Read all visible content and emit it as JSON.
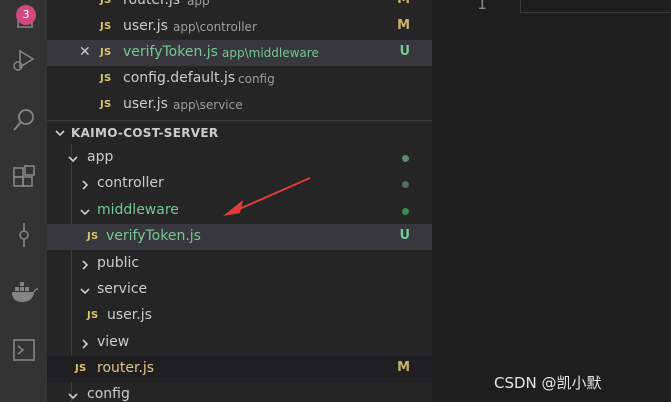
{
  "activity_bar": {
    "badge": "3",
    "icons": [
      "files-icon",
      "run-debug-icon",
      "search-icon",
      "extensions-icon",
      "source-control-icon",
      "docker-icon",
      "terminal-icon"
    ]
  },
  "open_editors": [
    {
      "name": "router.js",
      "path": "app",
      "status": "M"
    },
    {
      "name": "user.js",
      "path": "app\\controller",
      "status": "M"
    },
    {
      "name": "verifyToken.js",
      "path": "app\\middleware",
      "status": "U"
    },
    {
      "name": "config.default.js",
      "path": "config",
      "status": ""
    },
    {
      "name": "user.js",
      "path": "app\\service",
      "status": ""
    }
  ],
  "project": {
    "name": "KAIMO-COST-SERVER",
    "tree": [
      {
        "label": "app",
        "type": "folder-open"
      },
      {
        "label": "controller",
        "type": "folder"
      },
      {
        "label": "middleware",
        "type": "folder-open"
      },
      {
        "label": "verifyToken.js",
        "type": "file",
        "status": "U"
      },
      {
        "label": "public",
        "type": "folder"
      },
      {
        "label": "service",
        "type": "folder-open"
      },
      {
        "label": "user.js",
        "type": "file"
      },
      {
        "label": "view",
        "type": "folder"
      },
      {
        "label": "router.js",
        "type": "file",
        "status": "M"
      },
      {
        "label": "config",
        "type": "folder-open"
      }
    ]
  },
  "file_icon_text": "JS",
  "close_glyph": "✕",
  "editor": {
    "line_number": "1"
  },
  "watermark": "CSDN @凯小默",
  "colors": {
    "modified": "#c9b26b",
    "untracked": "#73c991",
    "selection": "#37373d",
    "annotation_arrow": "#e03c3c",
    "badge": "#d1497f"
  }
}
